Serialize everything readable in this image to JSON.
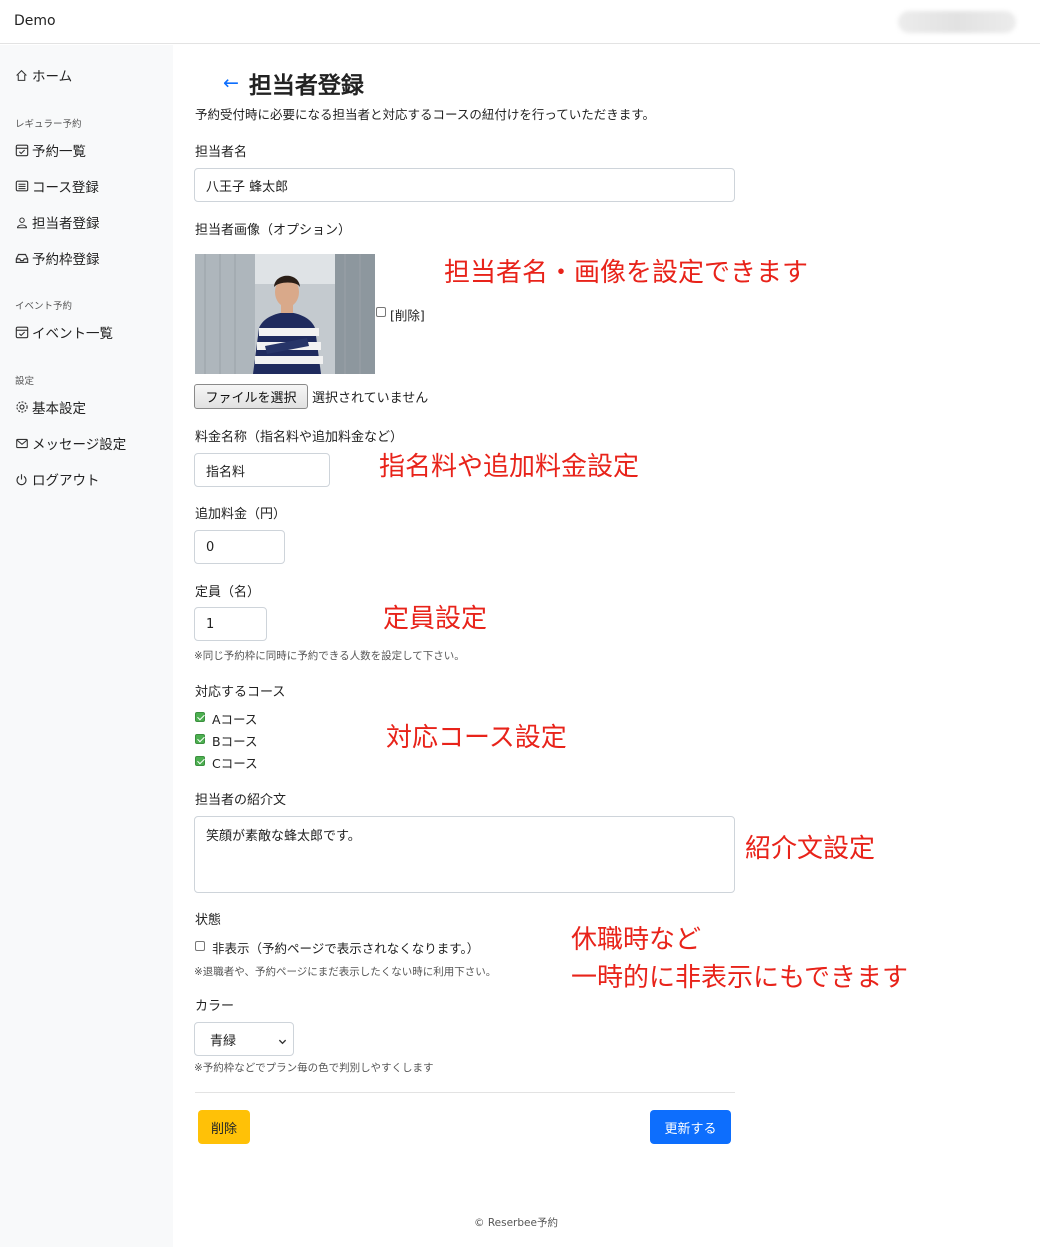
{
  "app": {
    "brand": "Demo"
  },
  "sidebar": {
    "home": "ホーム",
    "section_regular": "レギュラー予約",
    "reservation_list": "予約一覧",
    "course_register": "コース登録",
    "staff_register": "担当者登録",
    "slot_register": "予約枠登録",
    "section_event": "イベント予約",
    "event_list": "イベント一覧",
    "section_settings": "設定",
    "basic_settings": "基本設定",
    "message_settings": "メッセージ設定",
    "logout": "ログアウト"
  },
  "page": {
    "back_arrow": "←",
    "title": "担当者登録",
    "description": "予約受付時に必要になる担当者と対応するコースの紐付けを行っていただきます。"
  },
  "form": {
    "name_label": "担当者名",
    "name_value": "八王子 蜂太郎",
    "image_label": "担当者画像（オプション）",
    "image_delete_label": "[削除]",
    "file_button": "ファイルを選択",
    "file_status": "選択されていません",
    "fee_name_label": "料金名称（指名料や追加料金など）",
    "fee_name_value": "指名料",
    "extra_fee_label": "追加料金（円）",
    "extra_fee_value": "0",
    "capacity_label": "定員（名）",
    "capacity_value": "1",
    "capacity_note": "※同じ予約枠に同時に予約できる人数を設定して下さい。",
    "courses_label": "対応するコース",
    "courses": [
      {
        "label": "Aコース",
        "checked": true
      },
      {
        "label": "Bコース",
        "checked": true
      },
      {
        "label": "Cコース",
        "checked": true
      }
    ],
    "intro_label": "担当者の紹介文",
    "intro_value": "笑顔が素敵な蜂太郎です。",
    "status_label": "状態",
    "hidden_label": "非表示（予約ページで表示されなくなります。）",
    "hidden_checked": false,
    "hidden_note": "※退職者や、予約ページにまだ表示したくない時に利用下さい。",
    "color_label": "カラー",
    "color_value": "青緑",
    "color_note": "※予約枠などでプラン毎の色で判別しやすくします",
    "delete_button": "削除",
    "update_button": "更新する"
  },
  "annotations": {
    "name_image": "担当者名・画像を設定できます",
    "fee": "指名料や追加料金設定",
    "capacity": "定員設定",
    "courses": "対応コース設定",
    "intro": "紹介文設定",
    "hidden_line1": "休職時など",
    "hidden_line2": "一時的に非表示にもできます"
  },
  "footer": {
    "copyright": "© Reserbee予約"
  },
  "colors": {
    "primary": "#0d6efd",
    "warning": "#ffc107",
    "annotation": "#e8231a",
    "checkbox_checked": "#4caf50",
    "sidebar_bg": "#f8f9fa"
  }
}
